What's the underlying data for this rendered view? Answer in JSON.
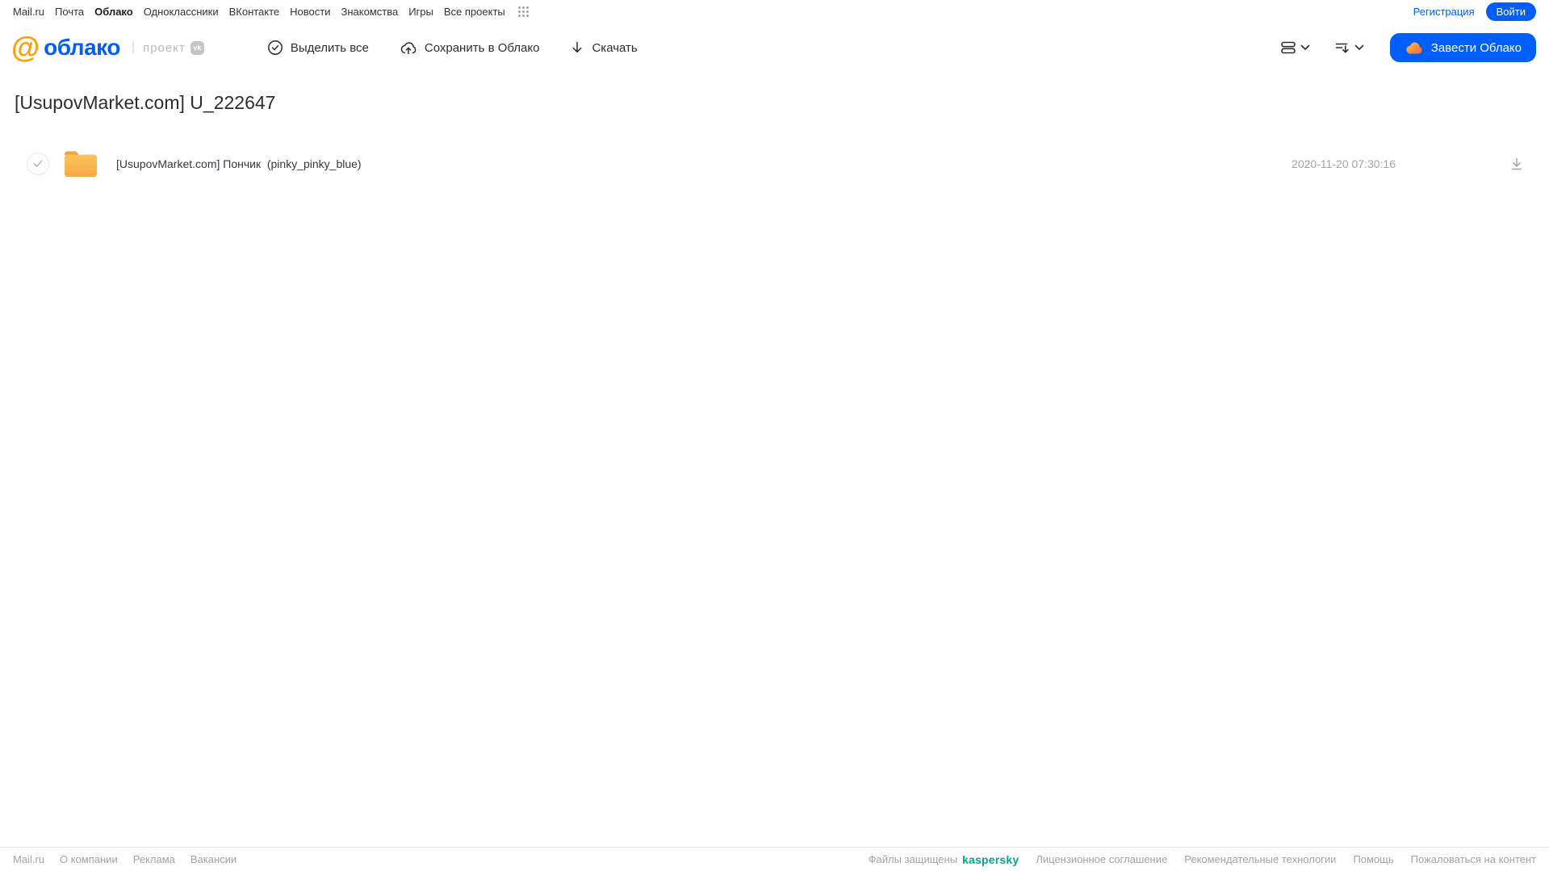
{
  "topnav": {
    "items": [
      "Mail.ru",
      "Почта",
      "Облако",
      "Одноклассники",
      "ВКонтакте",
      "Новости",
      "Знакомства",
      "Игры",
      "Все проекты"
    ],
    "active_item": "Облако",
    "register_label": "Регистрация",
    "login_label": "Войти"
  },
  "header": {
    "logo_at": "@",
    "logo_text": "облако",
    "divider": "|",
    "project_label": "проект",
    "vk_badge": "vk",
    "toolbar": {
      "select_all_label": "Выделить все",
      "save_label": "Сохранить в Облако",
      "download_label": "Скачать"
    },
    "get_cloud_label": "Завести Облако"
  },
  "page": {
    "title": "[UsupovMarket.com] U_222647"
  },
  "files": [
    {
      "type": "folder",
      "name": "[UsupovMarket.com] Пончик  (pinky_pinky_blue)",
      "date": "2020-11-20 07:30:16"
    }
  ],
  "footer": {
    "links_left": [
      "Mail.ru",
      "О компании",
      "Реклама",
      "Вакансии"
    ],
    "protected_prefix": "Файлы защищены",
    "kaspersky": "kaspersky",
    "links_right": [
      "Лицензионное соглашение",
      "Рекомендательные технологии",
      "Помощь",
      "Пожаловаться на контент"
    ]
  },
  "colors": {
    "accent_blue": "#005ff9",
    "logo_orange": "#ff9e00",
    "folder_orange": "#f9b44b",
    "kaspersky_teal": "#00a88e",
    "text_dark": "#2c2d2e",
    "text_grey": "#a0a2a6"
  }
}
